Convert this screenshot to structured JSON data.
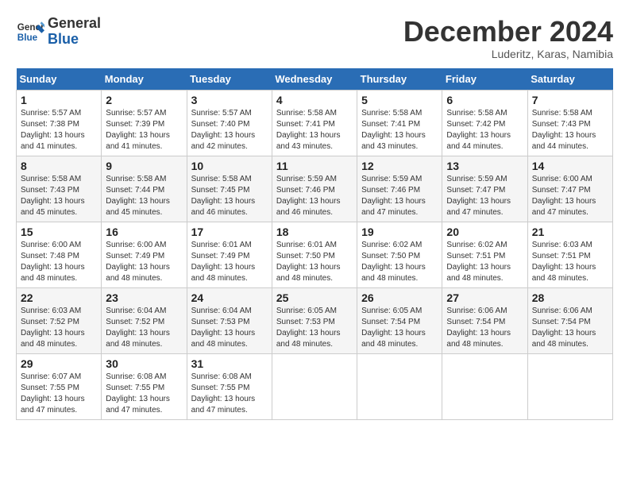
{
  "header": {
    "logo_line1": "General",
    "logo_line2": "Blue",
    "month": "December 2024",
    "location": "Luderitz, Karas, Namibia"
  },
  "days_of_week": [
    "Sunday",
    "Monday",
    "Tuesday",
    "Wednesday",
    "Thursday",
    "Friday",
    "Saturday"
  ],
  "weeks": [
    [
      {
        "day": "1",
        "info": "Sunrise: 5:57 AM\nSunset: 7:38 PM\nDaylight: 13 hours\nand 41 minutes."
      },
      {
        "day": "2",
        "info": "Sunrise: 5:57 AM\nSunset: 7:39 PM\nDaylight: 13 hours\nand 41 minutes."
      },
      {
        "day": "3",
        "info": "Sunrise: 5:57 AM\nSunset: 7:40 PM\nDaylight: 13 hours\nand 42 minutes."
      },
      {
        "day": "4",
        "info": "Sunrise: 5:58 AM\nSunset: 7:41 PM\nDaylight: 13 hours\nand 43 minutes."
      },
      {
        "day": "5",
        "info": "Sunrise: 5:58 AM\nSunset: 7:41 PM\nDaylight: 13 hours\nand 43 minutes."
      },
      {
        "day": "6",
        "info": "Sunrise: 5:58 AM\nSunset: 7:42 PM\nDaylight: 13 hours\nand 44 minutes."
      },
      {
        "day": "7",
        "info": "Sunrise: 5:58 AM\nSunset: 7:43 PM\nDaylight: 13 hours\nand 44 minutes."
      }
    ],
    [
      {
        "day": "8",
        "info": "Sunrise: 5:58 AM\nSunset: 7:43 PM\nDaylight: 13 hours\nand 45 minutes."
      },
      {
        "day": "9",
        "info": "Sunrise: 5:58 AM\nSunset: 7:44 PM\nDaylight: 13 hours\nand 45 minutes."
      },
      {
        "day": "10",
        "info": "Sunrise: 5:58 AM\nSunset: 7:45 PM\nDaylight: 13 hours\nand 46 minutes."
      },
      {
        "day": "11",
        "info": "Sunrise: 5:59 AM\nSunset: 7:46 PM\nDaylight: 13 hours\nand 46 minutes."
      },
      {
        "day": "12",
        "info": "Sunrise: 5:59 AM\nSunset: 7:46 PM\nDaylight: 13 hours\nand 47 minutes."
      },
      {
        "day": "13",
        "info": "Sunrise: 5:59 AM\nSunset: 7:47 PM\nDaylight: 13 hours\nand 47 minutes."
      },
      {
        "day": "14",
        "info": "Sunrise: 6:00 AM\nSunset: 7:47 PM\nDaylight: 13 hours\nand 47 minutes."
      }
    ],
    [
      {
        "day": "15",
        "info": "Sunrise: 6:00 AM\nSunset: 7:48 PM\nDaylight: 13 hours\nand 48 minutes."
      },
      {
        "day": "16",
        "info": "Sunrise: 6:00 AM\nSunset: 7:49 PM\nDaylight: 13 hours\nand 48 minutes."
      },
      {
        "day": "17",
        "info": "Sunrise: 6:01 AM\nSunset: 7:49 PM\nDaylight: 13 hours\nand 48 minutes."
      },
      {
        "day": "18",
        "info": "Sunrise: 6:01 AM\nSunset: 7:50 PM\nDaylight: 13 hours\nand 48 minutes."
      },
      {
        "day": "19",
        "info": "Sunrise: 6:02 AM\nSunset: 7:50 PM\nDaylight: 13 hours\nand 48 minutes."
      },
      {
        "day": "20",
        "info": "Sunrise: 6:02 AM\nSunset: 7:51 PM\nDaylight: 13 hours\nand 48 minutes."
      },
      {
        "day": "21",
        "info": "Sunrise: 6:03 AM\nSunset: 7:51 PM\nDaylight: 13 hours\nand 48 minutes."
      }
    ],
    [
      {
        "day": "22",
        "info": "Sunrise: 6:03 AM\nSunset: 7:52 PM\nDaylight: 13 hours\nand 48 minutes."
      },
      {
        "day": "23",
        "info": "Sunrise: 6:04 AM\nSunset: 7:52 PM\nDaylight: 13 hours\nand 48 minutes."
      },
      {
        "day": "24",
        "info": "Sunrise: 6:04 AM\nSunset: 7:53 PM\nDaylight: 13 hours\nand 48 minutes."
      },
      {
        "day": "25",
        "info": "Sunrise: 6:05 AM\nSunset: 7:53 PM\nDaylight: 13 hours\nand 48 minutes."
      },
      {
        "day": "26",
        "info": "Sunrise: 6:05 AM\nSunset: 7:54 PM\nDaylight: 13 hours\nand 48 minutes."
      },
      {
        "day": "27",
        "info": "Sunrise: 6:06 AM\nSunset: 7:54 PM\nDaylight: 13 hours\nand 48 minutes."
      },
      {
        "day": "28",
        "info": "Sunrise: 6:06 AM\nSunset: 7:54 PM\nDaylight: 13 hours\nand 48 minutes."
      }
    ],
    [
      {
        "day": "29",
        "info": "Sunrise: 6:07 AM\nSunset: 7:55 PM\nDaylight: 13 hours\nand 47 minutes."
      },
      {
        "day": "30",
        "info": "Sunrise: 6:08 AM\nSunset: 7:55 PM\nDaylight: 13 hours\nand 47 minutes."
      },
      {
        "day": "31",
        "info": "Sunrise: 6:08 AM\nSunset: 7:55 PM\nDaylight: 13 hours\nand 47 minutes."
      },
      {
        "day": "",
        "info": ""
      },
      {
        "day": "",
        "info": ""
      },
      {
        "day": "",
        "info": ""
      },
      {
        "day": "",
        "info": ""
      }
    ]
  ]
}
